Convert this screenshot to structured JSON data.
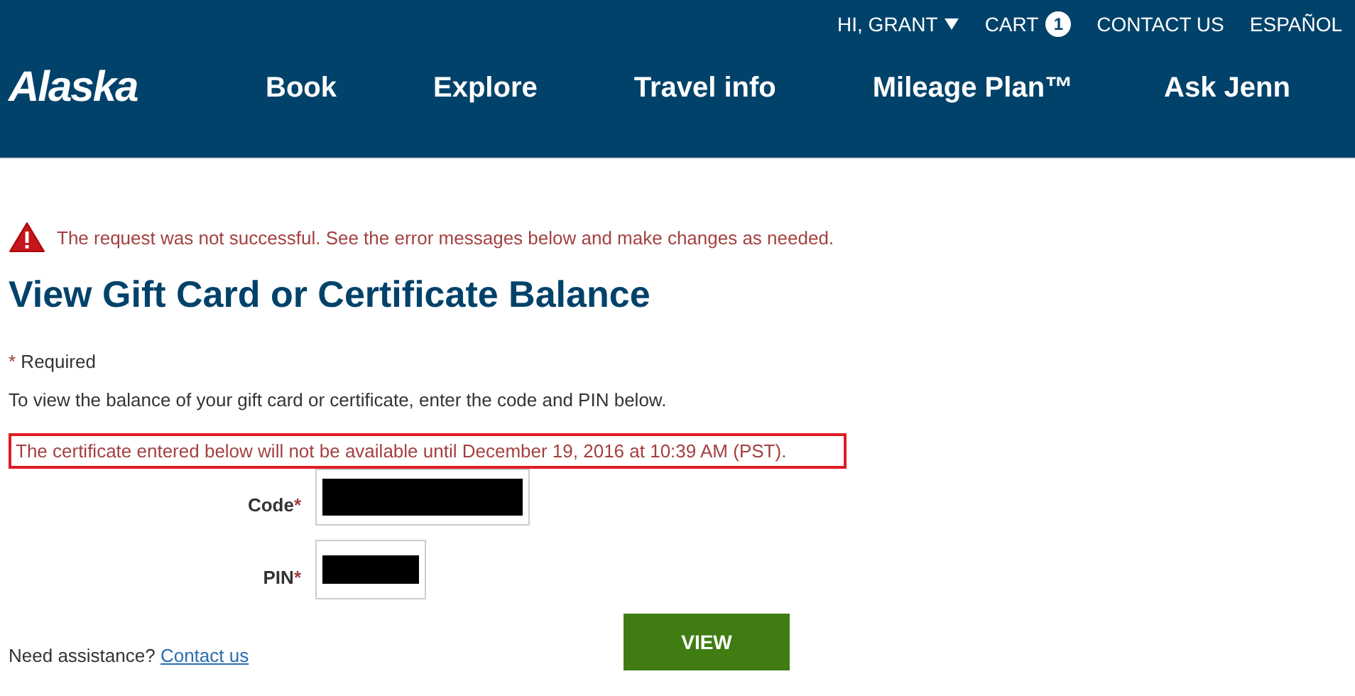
{
  "header": {
    "logo": "Alaska",
    "user_menu": "HI, GRANT",
    "cart": {
      "label": "CART",
      "count": "1"
    },
    "links": [
      "CONTACT US",
      "ESPAÑOL"
    ],
    "nav": [
      "Book",
      "Explore",
      "Travel info",
      "Mileage Plan™",
      "Ask Jenn"
    ]
  },
  "alert": "The request was not successful. See the error messages below and make changes as needed.",
  "title": "View Gift Card or Certificate Balance",
  "required": {
    "mark": "*",
    "text": "Required"
  },
  "intro": "To view the balance of your gift card or certificate, enter the code and PIN below.",
  "notice": "The certificate entered below will not be available until December 19, 2016 at 10:39 AM (PST).",
  "fields": [
    {
      "label": "Code",
      "mark": "*",
      "kind": "wide"
    },
    {
      "label": "PIN",
      "mark": "*",
      "kind": "narrow"
    }
  ],
  "button": "VIEW",
  "help": {
    "text": "Need assistance?",
    "link": "Contact us"
  }
}
